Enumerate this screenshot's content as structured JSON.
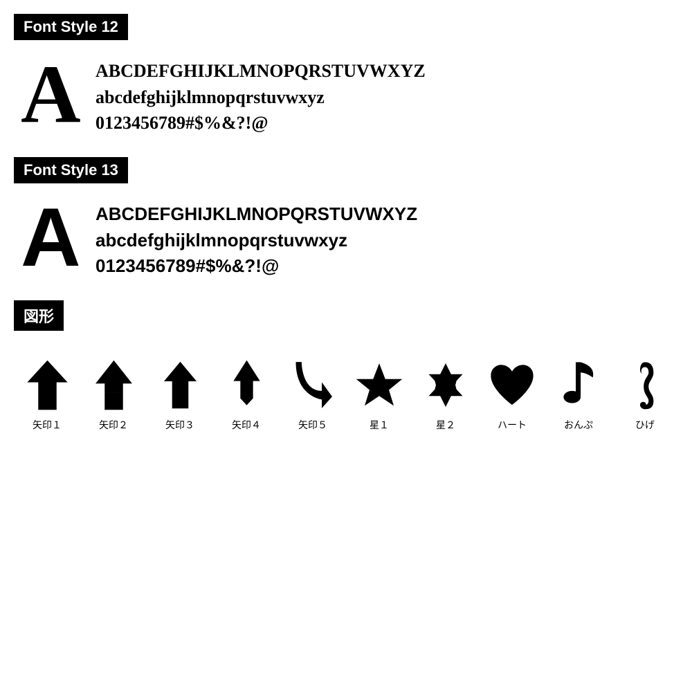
{
  "font12": {
    "label": "Font Style 12",
    "uppercase": "ABCDEFGHIJKLMNOPQRSTUVWXYZ",
    "lowercase": "abcdefghijklmnopqrstuvwxyz",
    "numbers": "0123456789#$%&?!@",
    "bigA": "A"
  },
  "font13": {
    "label": "Font Style 13",
    "uppercase": "ABCDEFGHIJKLMNOPQRSTUVWXYZ",
    "lowercase": "abcdefghijklmnopqrstuvwxyz",
    "numbers": "0123456789#$%&?!@",
    "bigA": "A"
  },
  "shapes": {
    "label": "図形",
    "items": [
      {
        "name": "矢印１",
        "id": "arrow1"
      },
      {
        "name": "矢印２",
        "id": "arrow2"
      },
      {
        "name": "矢印３",
        "id": "arrow3"
      },
      {
        "name": "矢印４",
        "id": "arrow4"
      },
      {
        "name": "矢印５",
        "id": "arrow5"
      },
      {
        "name": "星１",
        "id": "star1"
      },
      {
        "name": "星２",
        "id": "star2"
      },
      {
        "name": "ハート",
        "id": "heart"
      },
      {
        "name": "おんぷ",
        "id": "music"
      },
      {
        "name": "ひげ",
        "id": "mustache"
      }
    ]
  }
}
